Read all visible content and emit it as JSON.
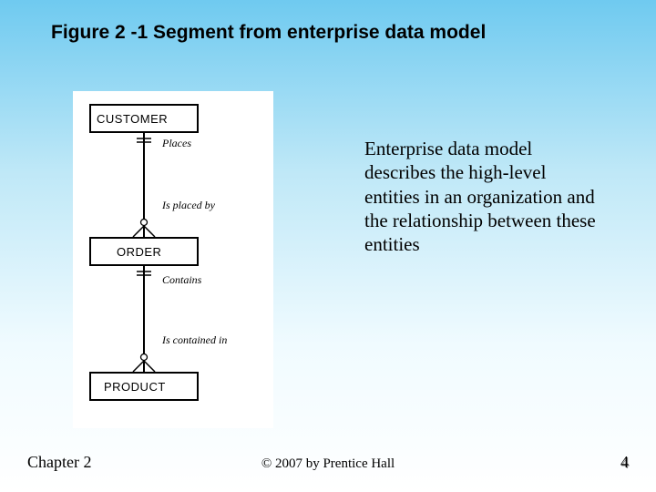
{
  "title": "Figure 2 -1 Segment from enterprise data model",
  "diagram": {
    "entities": [
      "CUSTOMER",
      "ORDER",
      "PRODUCT"
    ],
    "relationships": [
      {
        "forward": "Places",
        "backward": "Is placed by"
      },
      {
        "forward": "Contains",
        "backward": "Is contained in"
      }
    ]
  },
  "description": "Enterprise data model describes the high-level entities in an organization and the relationship between these entities",
  "footer": {
    "chapter": "Chapter 2",
    "copyright": "© 2007 by Prentice Hall",
    "page": "4"
  }
}
